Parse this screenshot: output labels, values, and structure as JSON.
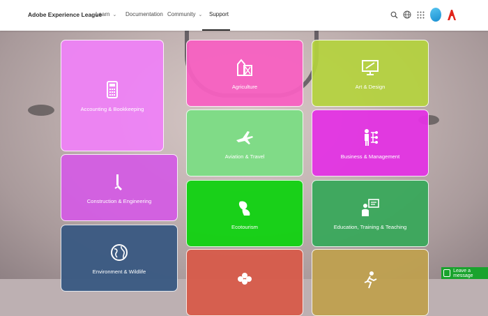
{
  "header": {
    "brand": "Adobe Experience League",
    "nav": [
      {
        "label": "Learn",
        "has_dropdown": true
      },
      {
        "label": "Documentation",
        "has_dropdown": false
      },
      {
        "label": "Community",
        "has_dropdown": true
      },
      {
        "label": "Support",
        "has_dropdown": false,
        "active": true
      }
    ],
    "icons": [
      "search-icon",
      "globe-icon",
      "apps-grid-icon",
      "avatar",
      "adobe-logo"
    ]
  },
  "tiles": [
    {
      "label": "Accounting & Bookkeeping",
      "icon": "calculator-icon",
      "color": "#ee82f5"
    },
    {
      "label": "Agriculture",
      "icon": "barn-icon",
      "color": "#f760c1"
    },
    {
      "label": "Art & Design",
      "icon": "monitor-icon",
      "color": "#b4d23d"
    },
    {
      "label": "Aviation & Travel",
      "icon": "airplane-icon",
      "color": "#7bdc84"
    },
    {
      "label": "Business & Management",
      "icon": "org-chart-icon",
      "color": "#e333e3"
    },
    {
      "label": "Construction & Engineering",
      "icon": "hammer-icon",
      "color": "#d35de3"
    },
    {
      "label": "Ecotourism",
      "icon": "eco-icon",
      "color": "#14d114"
    },
    {
      "label": "Education, Training & Teaching",
      "icon": "teacher-icon",
      "color": "#39a85b"
    },
    {
      "label": "Environment & Wildlife",
      "icon": "earth-icon",
      "color": "#3b5a82"
    },
    {
      "label": "",
      "icon": "flower-icon",
      "color": "#d75b4a"
    },
    {
      "label": "",
      "icon": "runner-icon",
      "color": "#bfa04f"
    }
  ],
  "chat": {
    "label": "Leave a message"
  }
}
